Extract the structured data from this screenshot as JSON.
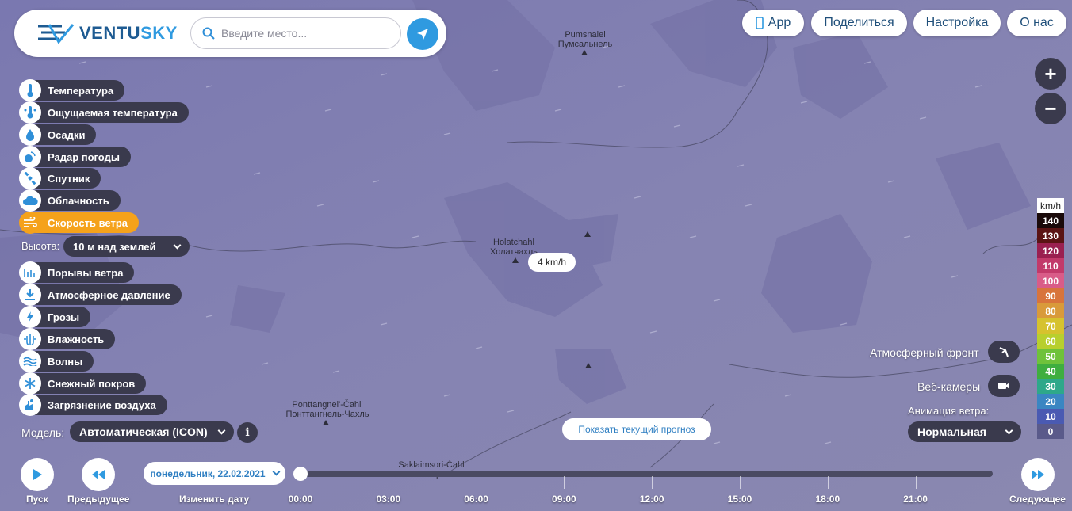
{
  "header": {
    "brand_prefix": "VENTU",
    "brand_suffix": "SKY",
    "search_placeholder": "Введите место...",
    "nav": [
      {
        "label": "App"
      },
      {
        "label": "Поделиться"
      },
      {
        "label": "Настройка"
      },
      {
        "label": "О нас"
      }
    ]
  },
  "layers": [
    {
      "label": "Температура",
      "icon": "thermometer-icon",
      "active": false
    },
    {
      "label": "Ощущаемая температура",
      "icon": "feels-like-icon",
      "active": false
    },
    {
      "label": "Осадки",
      "icon": "raindrop-icon",
      "active": false
    },
    {
      "label": "Радар погоды",
      "icon": "radar-icon",
      "active": false
    },
    {
      "label": "Спутник",
      "icon": "satellite-icon",
      "active": false
    },
    {
      "label": "Облачность",
      "icon": "cloud-icon",
      "active": false
    },
    {
      "label": "Скорость ветра",
      "icon": "wind-icon",
      "active": true
    }
  ],
  "height_control": {
    "label": "Высота:",
    "value": "10 м над землей"
  },
  "layers2": [
    {
      "label": "Порывы ветра",
      "icon": "gusts-icon"
    },
    {
      "label": "Атмосферное давление",
      "icon": "pressure-icon"
    },
    {
      "label": "Грозы",
      "icon": "lightning-icon"
    },
    {
      "label": "Влажность",
      "icon": "humidity-icon"
    },
    {
      "label": "Волны",
      "icon": "waves-icon"
    },
    {
      "label": "Снежный покров",
      "icon": "snowflake-icon"
    },
    {
      "label": "Загрязнение воздуха",
      "icon": "pollution-icon"
    }
  ],
  "model": {
    "label": "Модель:",
    "value": "Автоматическая (ICON)",
    "info": "i"
  },
  "map": {
    "places": [
      {
        "latin": "Pumsnalel",
        "cyr": "Пумсальнель"
      },
      {
        "latin": "Holatchahl",
        "cyr": "Холатчахль"
      },
      {
        "latin": "Ponttangnel'-Čahl'",
        "cyr": "Понттангнель-Чахль"
      },
      {
        "latin": "Saklaimsori-Čahl'",
        "cyr": "Саклаимсори-Чахль"
      }
    ],
    "wind_value": "4 km/h"
  },
  "right_panel": {
    "front_label": "Атмосферный фронт",
    "webcam_label": "Веб-камеры",
    "animation_label": "Анимация ветра:",
    "animation_value": "Нормальная",
    "zoom_in": "+",
    "zoom_out": "−"
  },
  "legend": {
    "unit": "km/h",
    "steps": [
      {
        "v": "140",
        "c": "#1a0a0a"
      },
      {
        "v": "130",
        "c": "#5a1414"
      },
      {
        "v": "120",
        "c": "#9a2050"
      },
      {
        "v": "110",
        "c": "#c23a6a"
      },
      {
        "v": "100",
        "c": "#d95c88"
      },
      {
        "v": "90",
        "c": "#d8743c"
      },
      {
        "v": "80",
        "c": "#d99a3a"
      },
      {
        "v": "70",
        "c": "#d6c22e"
      },
      {
        "v": "60",
        "c": "#b8cf2e"
      },
      {
        "v": "50",
        "c": "#6fc23a"
      },
      {
        "v": "40",
        "c": "#3fae3f"
      },
      {
        "v": "30",
        "c": "#2ea88a"
      },
      {
        "v": "20",
        "c": "#3a86c2"
      },
      {
        "v": "10",
        "c": "#4a5ab2"
      },
      {
        "v": "0",
        "c": "#5a5a8a"
      }
    ]
  },
  "forecast_button": "Показать текущий прогноз",
  "timeline": {
    "play": "Пуск",
    "prev": "Предыдущее",
    "change_date": "Изменить дату",
    "next": "Следующее",
    "date": "понедельник, 22.02.2021",
    "hours": [
      "00:00",
      "03:00",
      "06:00",
      "09:00",
      "12:00",
      "15:00",
      "18:00",
      "21:00"
    ]
  }
}
